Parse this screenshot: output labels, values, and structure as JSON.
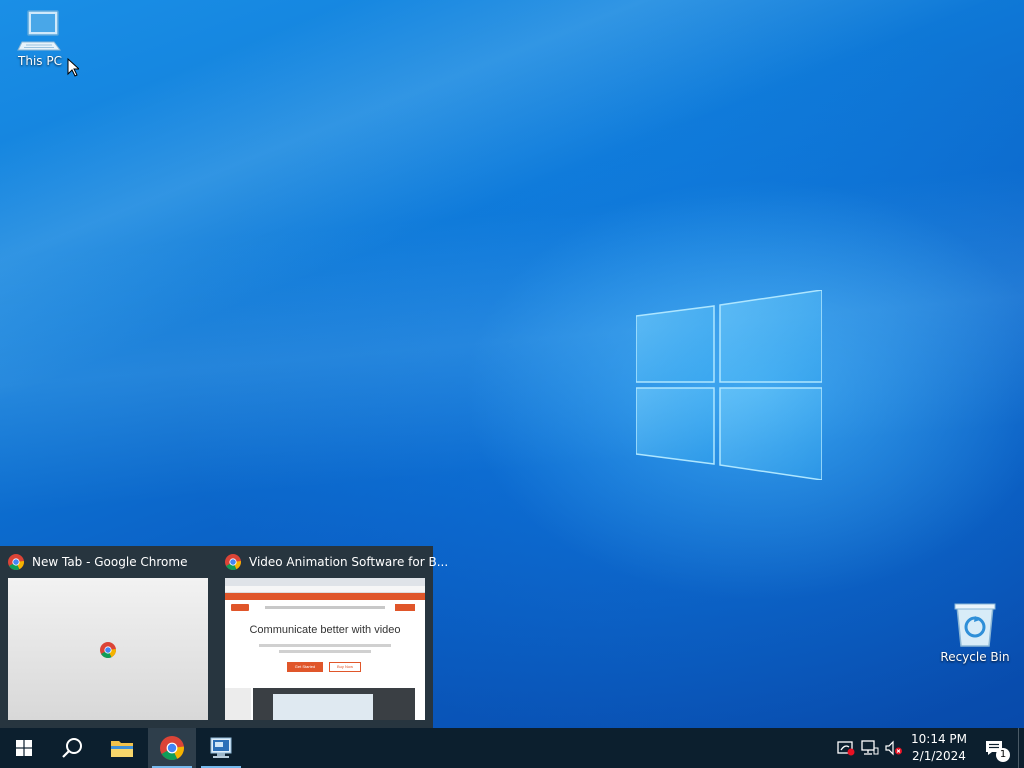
{
  "desktop": {
    "icons": [
      {
        "label": "This PC"
      },
      {
        "label": "Recycle Bin"
      }
    ]
  },
  "taskbar_thumbnails": [
    {
      "title": "New Tab - Google Chrome"
    },
    {
      "title": "Video Animation Software for B...",
      "preview": {
        "headline": "Communicate better with video",
        "primary_button": "Get Started",
        "secondary_button": "Buy Now"
      }
    }
  ],
  "taskbar": {
    "pinned": [
      "start-button",
      "search-button",
      "file-explorer",
      "google-chrome",
      "remote-desktop"
    ],
    "clock_time": "10:14 PM",
    "clock_date": "2/1/2024",
    "notification_count": "1"
  },
  "colors": {
    "taskbar": "#0c1f2e",
    "thumbnail_popup": "#27353f",
    "vyond_orange": "#e0562a"
  }
}
